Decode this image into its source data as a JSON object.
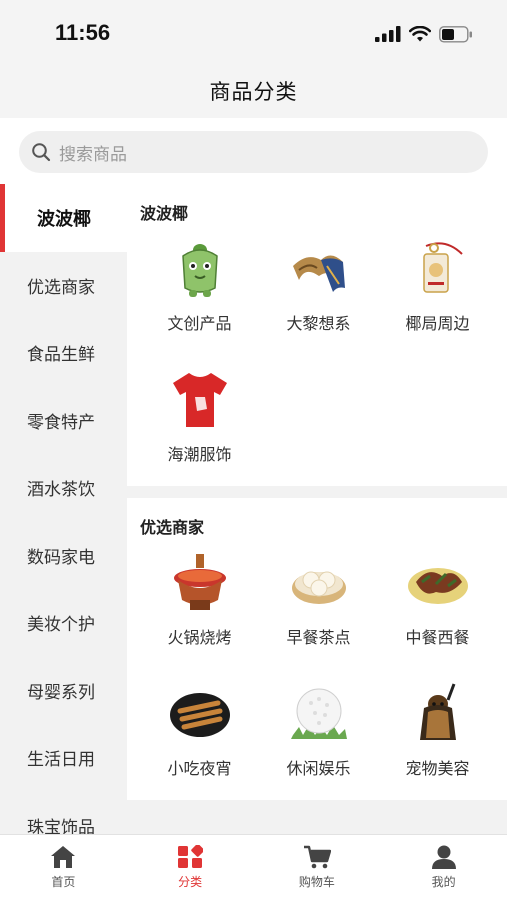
{
  "status_bar": {
    "time": "11:56"
  },
  "nav": {
    "title": "商品分类"
  },
  "search": {
    "placeholder": "搜索商品"
  },
  "sidebar": {
    "items": [
      {
        "label": "波波椰",
        "active": true
      },
      {
        "label": "优选商家"
      },
      {
        "label": "食品生鲜"
      },
      {
        "label": "零食特产"
      },
      {
        "label": "酒水茶饮"
      },
      {
        "label": "数码家电"
      },
      {
        "label": "美妆个护"
      },
      {
        "label": "母婴系列"
      },
      {
        "label": "生活日用"
      },
      {
        "label": "珠宝饰品"
      }
    ]
  },
  "sections": [
    {
      "title": "波波椰",
      "items": [
        {
          "label": "文创产品",
          "icon": "mascot-figure-icon"
        },
        {
          "label": "大黎想系",
          "icon": "scarf-icon"
        },
        {
          "label": "椰局周边",
          "icon": "tag-keychain-icon"
        },
        {
          "label": "海潮服饰",
          "icon": "tshirt-icon"
        }
      ]
    },
    {
      "title": "优选商家",
      "items": [
        {
          "label": "火锅烧烤",
          "icon": "hotpot-icon"
        },
        {
          "label": "早餐茶点",
          "icon": "dumpling-icon"
        },
        {
          "label": "中餐西餐",
          "icon": "dish-icon"
        },
        {
          "label": "小吃夜宵",
          "icon": "snack-plate-icon"
        },
        {
          "label": "休闲娱乐",
          "icon": "golf-ball-icon"
        },
        {
          "label": "宠物美容",
          "icon": "dog-icon"
        }
      ]
    }
  ],
  "tabbar": {
    "items": [
      {
        "label": "首页",
        "icon": "home-icon"
      },
      {
        "label": "分类",
        "icon": "category-icon",
        "active": true
      },
      {
        "label": "购物车",
        "icon": "cart-icon"
      },
      {
        "label": "我的",
        "icon": "user-icon"
      }
    ]
  },
  "colors": {
    "accent": "#e03535",
    "background": "#f2f2f2"
  }
}
